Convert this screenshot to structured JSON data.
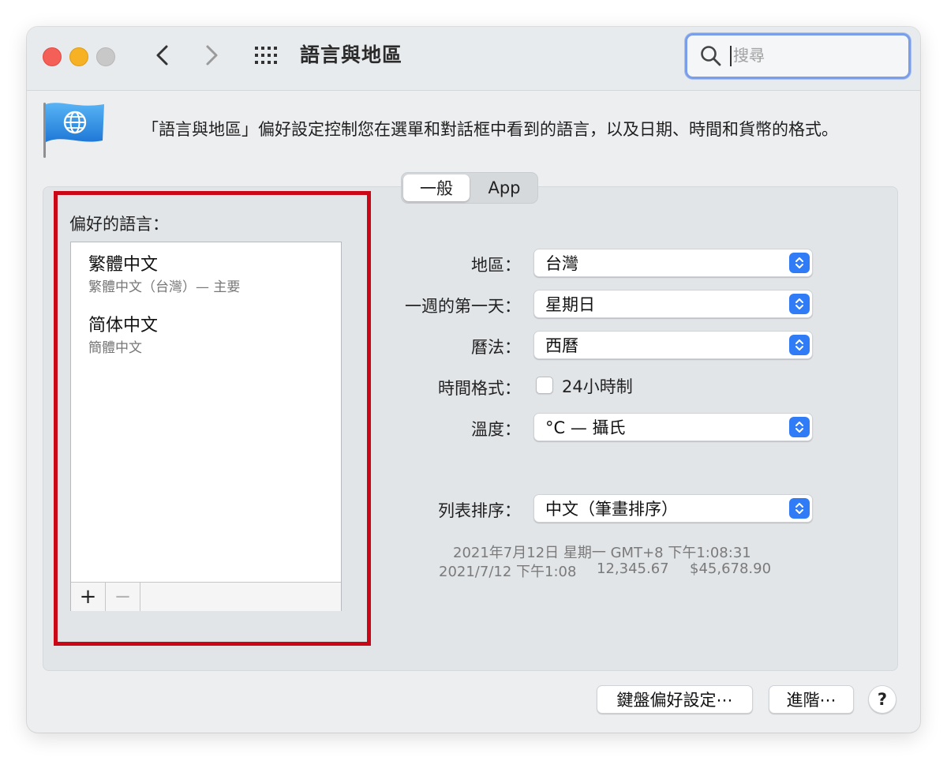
{
  "window": {
    "title": "語言與地區",
    "search": {
      "placeholder": "搜尋",
      "value": ""
    },
    "traffic_lights": {
      "close_color": "#f45f58",
      "minimize_color": "#f6b124",
      "zoom_color": "#c8c8c8"
    },
    "nav_icons": [
      "chevron-left-icon",
      "chevron-right-icon",
      "grid-icon"
    ]
  },
  "description": "「語言與地區」偏好設定控制您在選單和對話框中看到的語言，以及日期、時間和貨幣的格式。",
  "tabs": [
    {
      "label": "一般",
      "selected": true
    },
    {
      "label": "App",
      "selected": false
    }
  ],
  "languages": {
    "title": "偏好的語言：",
    "items": [
      {
        "name": "繁體中文",
        "detail": "繁體中文（台灣）— 主要"
      },
      {
        "name": "简体中文",
        "detail": "簡體中文"
      }
    ],
    "add_label": "+",
    "remove_label": "−",
    "highlight_color": "#c90716"
  },
  "settings": {
    "region": {
      "label": "地區：",
      "value": "台灣"
    },
    "first_day": {
      "label": "一週的第一天：",
      "value": "星期日"
    },
    "calendar": {
      "label": "曆法：",
      "value": "西曆"
    },
    "time_format": {
      "label": "時間格式：",
      "checkbox_label": "24小時制",
      "checked": false
    },
    "temperature": {
      "label": "溫度：",
      "value": "°C — 攝氏"
    },
    "list_sort": {
      "label": "列表排序：",
      "value": "中文（筆畫排序）"
    }
  },
  "sample": {
    "line1": "2021年7月12日 星期一 GMT+8 下午1:08:31",
    "date_short": "2021/7/12 下午1:08",
    "number": "12,345.67",
    "currency": "$45,678.90"
  },
  "buttons": {
    "keyboard_prefs": "鍵盤偏好設定⋯",
    "advanced": "進階⋯",
    "help": "?"
  },
  "accent_color": "#2f7cf6"
}
